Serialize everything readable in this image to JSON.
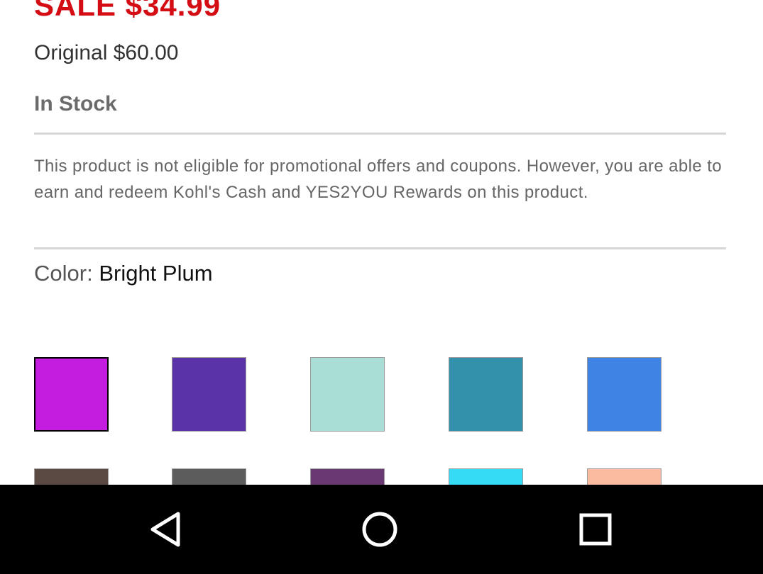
{
  "product": {
    "sale_price": "SALE $34.99",
    "original_price": "Original $60.00",
    "stock_status": "In Stock",
    "promo_note": "This product is not eligible for promotional offers and coupons.  However, you are able to earn and redeem Kohl's Cash and YES2YOU Rewards on this product.",
    "color_label": "Color: ",
    "color_value": "Bright Plum"
  },
  "swatches": [
    {
      "color": "#c51ddf",
      "selected": true
    },
    {
      "color": "#5a33a8",
      "selected": false
    },
    {
      "color": "#a9ded6",
      "selected": false
    },
    {
      "color": "#3391ab",
      "selected": false
    },
    {
      "color": "#3f84e4",
      "selected": false
    },
    {
      "color": "#5b4943",
      "selected": false
    },
    {
      "color": "#5c5c5c",
      "selected": false
    },
    {
      "color": "#6a3872",
      "selected": false
    },
    {
      "color": "#35dbf4",
      "selected": false
    },
    {
      "color": "#fbbba1",
      "selected": false
    }
  ],
  "theme": {
    "sale_color": "#d40c13",
    "nav_background": "#000000"
  },
  "nav": {
    "back_icon": "back-triangle-icon",
    "home_icon": "home-circle-icon",
    "recents_icon": "recents-square-icon"
  }
}
